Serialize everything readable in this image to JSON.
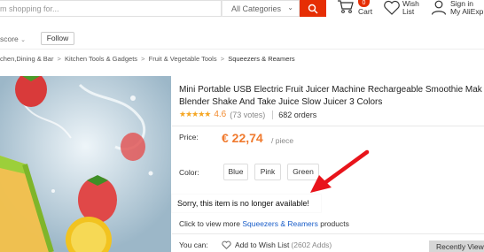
{
  "header": {
    "search_placeholder": "m shopping for...",
    "category": "All Categories",
    "cart_count": "0",
    "cart_label": "Cart",
    "wish_label_line1": "Wish",
    "wish_label_line2": "List",
    "account_line1": "Sign in",
    "account_line2": "My AliExp"
  },
  "store": {
    "score_label": "score",
    "follow_label": "Follow"
  },
  "breadcrumb": {
    "items": [
      "chen,Dining & Bar",
      "Kitchen Tools & Gadgets",
      "Fruit & Vegetable Tools"
    ],
    "current": "Squeezers & Reamers",
    "separator": ">"
  },
  "product": {
    "title_line1": "Mini Portable USB Electric Fruit Juicer Machine Rechargeable Smoothie Mak",
    "title_line2": "Blender Shake And Take Juice Slow Juicer 3 Colors",
    "rating_value": "4.6",
    "rating_fraction": 0.92,
    "votes": "(73 votes)",
    "orders": "682 orders",
    "price_label": "Price:",
    "price_value": "€ 22,74",
    "price_unit": "/ piece",
    "color_label": "Color:",
    "colors": [
      "Blue",
      "Pink",
      "Green"
    ],
    "unavailable_message": "Sorry, this item is no longer available!",
    "related_prefix": "Click to view more",
    "related_link": "Squeezers & Reamers",
    "related_suffix": "products",
    "you_can_label": "You can:",
    "wishlist_label": "Add to Wish List",
    "wishlist_count": "(2602 Adds)",
    "recently_viewed": "Recently View"
  },
  "colors": {
    "accent": "#e62e04",
    "price": "#f07a2e",
    "link": "#1a5ec9",
    "star": "#f5a623",
    "arrow": "#e8141b"
  }
}
